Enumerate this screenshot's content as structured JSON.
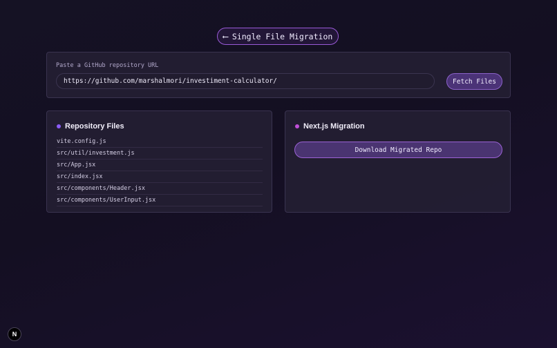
{
  "header": {
    "back_arrow": "⟵",
    "title": "Single File Migration"
  },
  "url_section": {
    "label": "Paste a GitHub repository URL",
    "input_value": "https://github.com/marshalmori/investiment-calculator/",
    "fetch_label": "Fetch Files"
  },
  "repo_files": {
    "title": "Repository Files",
    "dot_color": "#8b5cf6",
    "files": [
      "vite.config.js",
      "src/util/investment.js",
      "src/App.jsx",
      "src/index.jsx",
      "src/components/Header.jsx",
      "src/components/UserInput.jsx"
    ]
  },
  "migration": {
    "title": "Next.js Migration",
    "dot_color": "#c04fd8",
    "download_label": "Download Migrated Repo"
  },
  "badge": {
    "letter": "N",
    "icon": "nextjs-logo-icon"
  },
  "colors": {
    "accent": "#9a5ad8",
    "button_bg": "#4b3377",
    "panel_bg": "#252034"
  }
}
